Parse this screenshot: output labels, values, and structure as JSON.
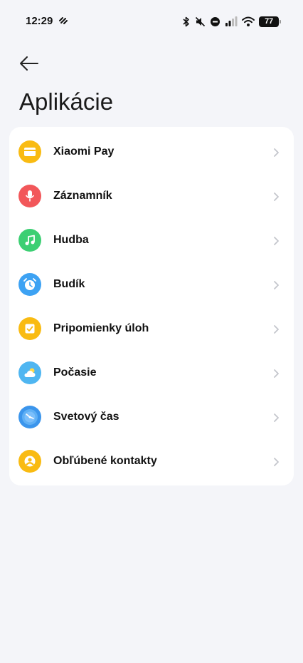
{
  "status_bar": {
    "time": "12:29",
    "battery": "77",
    "icons": [
      "bluetooth-icon",
      "mute-icon",
      "do-not-disturb-icon",
      "signal-icon",
      "wifi-icon",
      "battery-icon"
    ]
  },
  "header": {
    "back_icon": "arrow-left-icon",
    "title": "Aplikácie"
  },
  "apps": [
    {
      "label": "Xiaomi Pay",
      "icon": "wallet-icon",
      "color": "#f9bb12"
    },
    {
      "label": "Záznamník",
      "icon": "microphone-icon",
      "color": "#f2575a"
    },
    {
      "label": "Hudba",
      "icon": "music-note-icon",
      "color": "#3ccf73"
    },
    {
      "label": "Budík",
      "icon": "alarm-clock-icon",
      "color": "#3da2f3"
    },
    {
      "label": "Pripomienky úloh",
      "icon": "task-check-icon",
      "color": "#f9bb12"
    },
    {
      "label": "Počasie",
      "icon": "weather-icon",
      "color": "#4fb6f1"
    },
    {
      "label": "Svetový čas",
      "icon": "world-clock-icon",
      "color": "#3b95ec"
    },
    {
      "label": "Obľúbené kontakty",
      "icon": "contact-icon",
      "color": "#f9bb12"
    }
  ]
}
